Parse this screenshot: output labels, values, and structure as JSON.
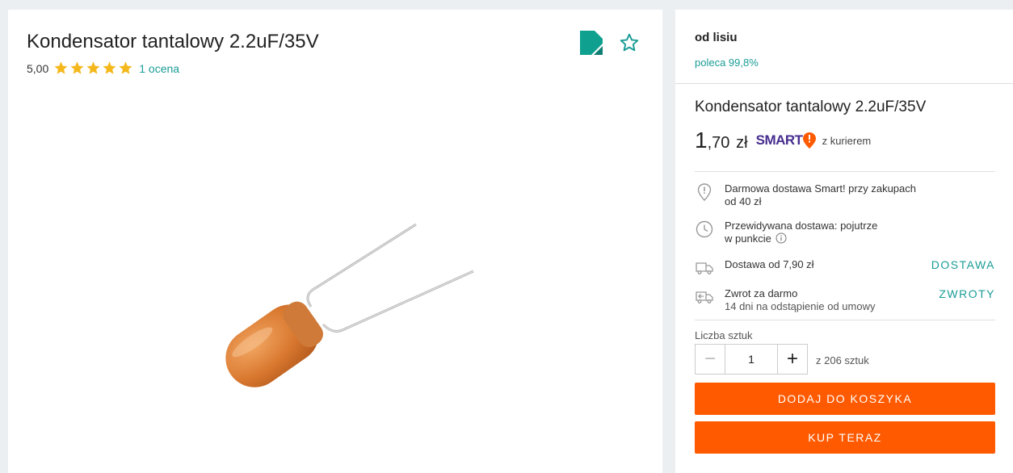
{
  "product": {
    "title": "Kondensator tantalowy 2.2uF/35V",
    "rating_value": "5,00",
    "rating_stars": 5,
    "rating_count": "1 ocena"
  },
  "icons": {
    "bookmark": "bookmark-icon",
    "favorite": "star-outline-icon",
    "star": "star-icon"
  },
  "seller": {
    "name": "od lisiu",
    "recommend": "poleca 99,8%"
  },
  "offer": {
    "title": "Kondensator tantalowy 2.2uF/35V",
    "price_int": "1",
    "price_dec": ",70",
    "price_cur": "zł",
    "smart_label": "SMART",
    "courier": "z kurierem"
  },
  "delivery": {
    "free": {
      "line1": "Darmowa dostawa Smart! przy zakupach",
      "line2": "od 40 zł"
    },
    "expected": {
      "line1": "Przewidywana dostawa: pojutrze",
      "line2": "w punkcie"
    },
    "shipping": {
      "text": "Dostawa od 7,90 zł",
      "link": "DOSTAWA"
    },
    "returns": {
      "line1": "Zwrot za darmo",
      "line2": "14 dni na odstąpienie od umowy",
      "link": "ZWROTY"
    }
  },
  "quantity": {
    "label": "Liczba sztuk",
    "minus": "−",
    "value": "1",
    "plus": "+",
    "stock": "z 206 sztuk"
  },
  "buttons": {
    "add_to_cart": "DODAJ DO KOSZYKA",
    "buy_now": "KUP TERAZ"
  },
  "colors": {
    "accent": "#1a9c96",
    "cta": "#ff5a00",
    "star": "#f5b81c",
    "smart_purple": "#462d8f",
    "smart_orange": "#ff5a00"
  }
}
